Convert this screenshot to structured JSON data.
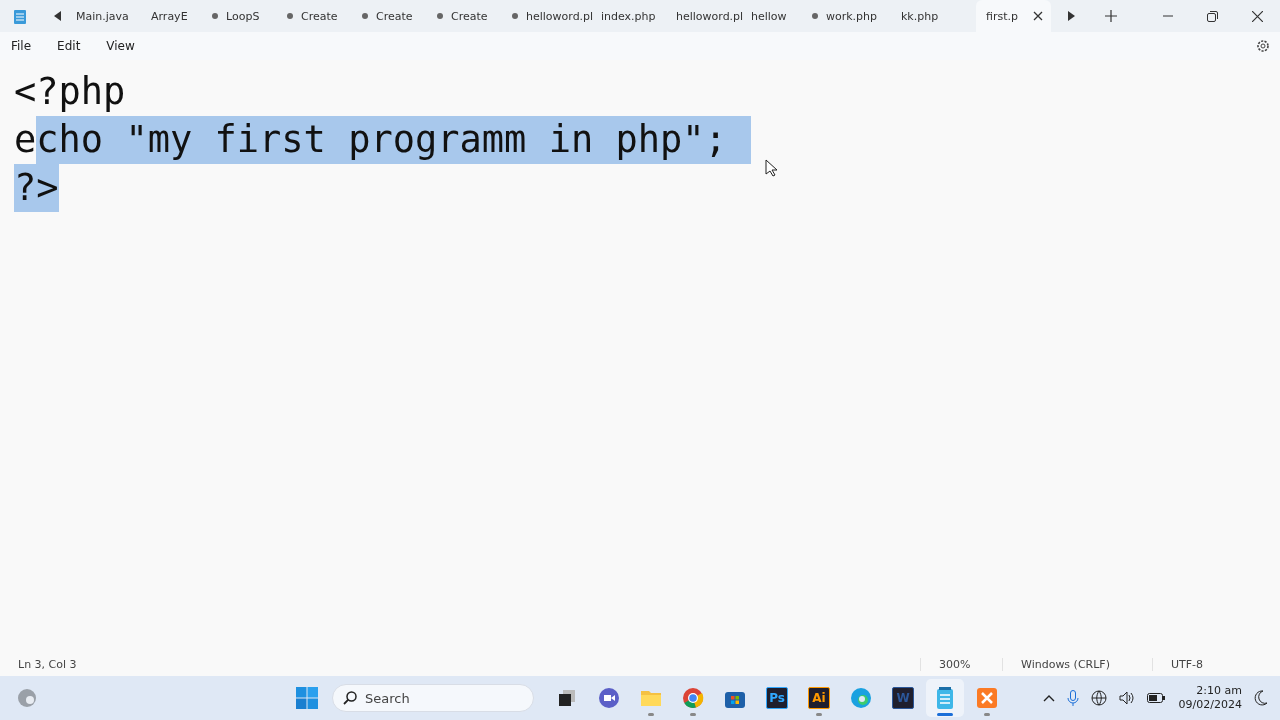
{
  "tabs": [
    {
      "label": "Main.java",
      "modified": false,
      "selected": false
    },
    {
      "label": "ArrayE",
      "modified": true,
      "selected": false
    },
    {
      "label": "LoopS",
      "modified": true,
      "selected": false
    },
    {
      "label": "Create",
      "modified": true,
      "selected": false
    },
    {
      "label": "Create",
      "modified": true,
      "selected": false
    },
    {
      "label": "Create",
      "modified": true,
      "selected": false
    },
    {
      "label": "helloword.pl",
      "modified": false,
      "selected": false
    },
    {
      "label": "index.php",
      "modified": false,
      "selected": false
    },
    {
      "label": "helloword.pl",
      "modified": false,
      "selected": false
    },
    {
      "label": "hellow",
      "modified": true,
      "selected": false
    },
    {
      "label": "work.php",
      "modified": false,
      "selected": false
    },
    {
      "label": "kk.php",
      "modified": false,
      "selected": false
    },
    {
      "label": "first.p",
      "modified": false,
      "selected": true
    }
  ],
  "menu": [
    "File",
    "Edit",
    "View"
  ],
  "editor": {
    "lines": [
      {
        "plain": "<?php"
      },
      {
        "plain": "e",
        "selected": "cho \"my first programm in php\";",
        "eol_selected": true
      },
      {
        "selected": "?>",
        "eol_selected": false
      }
    ]
  },
  "status_bar": {
    "position": "Ln 3, Col 3",
    "zoom": "300%",
    "line_ending": "Windows (CRLF)",
    "encoding": "UTF-8"
  },
  "taskbar": {
    "search": {
      "placeholder": "Search"
    },
    "apps": [
      {
        "kind": "taskview",
        "running": false,
        "active": false
      },
      {
        "kind": "meet",
        "running": false,
        "active": false
      },
      {
        "kind": "folder",
        "running": true,
        "active": false
      },
      {
        "kind": "chrome",
        "running": true,
        "active": false
      },
      {
        "kind": "store",
        "running": false,
        "active": false
      },
      {
        "kind": "badge",
        "label": "Ps",
        "color": "#31a8ff",
        "running": false,
        "active": false
      },
      {
        "kind": "badge",
        "label": "Ai",
        "color": "#ff9a00",
        "running": true,
        "active": false
      },
      {
        "kind": "edge",
        "running": false,
        "active": false
      },
      {
        "kind": "badge",
        "label": "W",
        "color": "#2b579a",
        "running": false,
        "active": false
      },
      {
        "kind": "notepad",
        "running": true,
        "active": true
      },
      {
        "kind": "xampp",
        "running": true,
        "active": false
      }
    ],
    "time": "2:10 am",
    "date": "09/02/2024"
  }
}
